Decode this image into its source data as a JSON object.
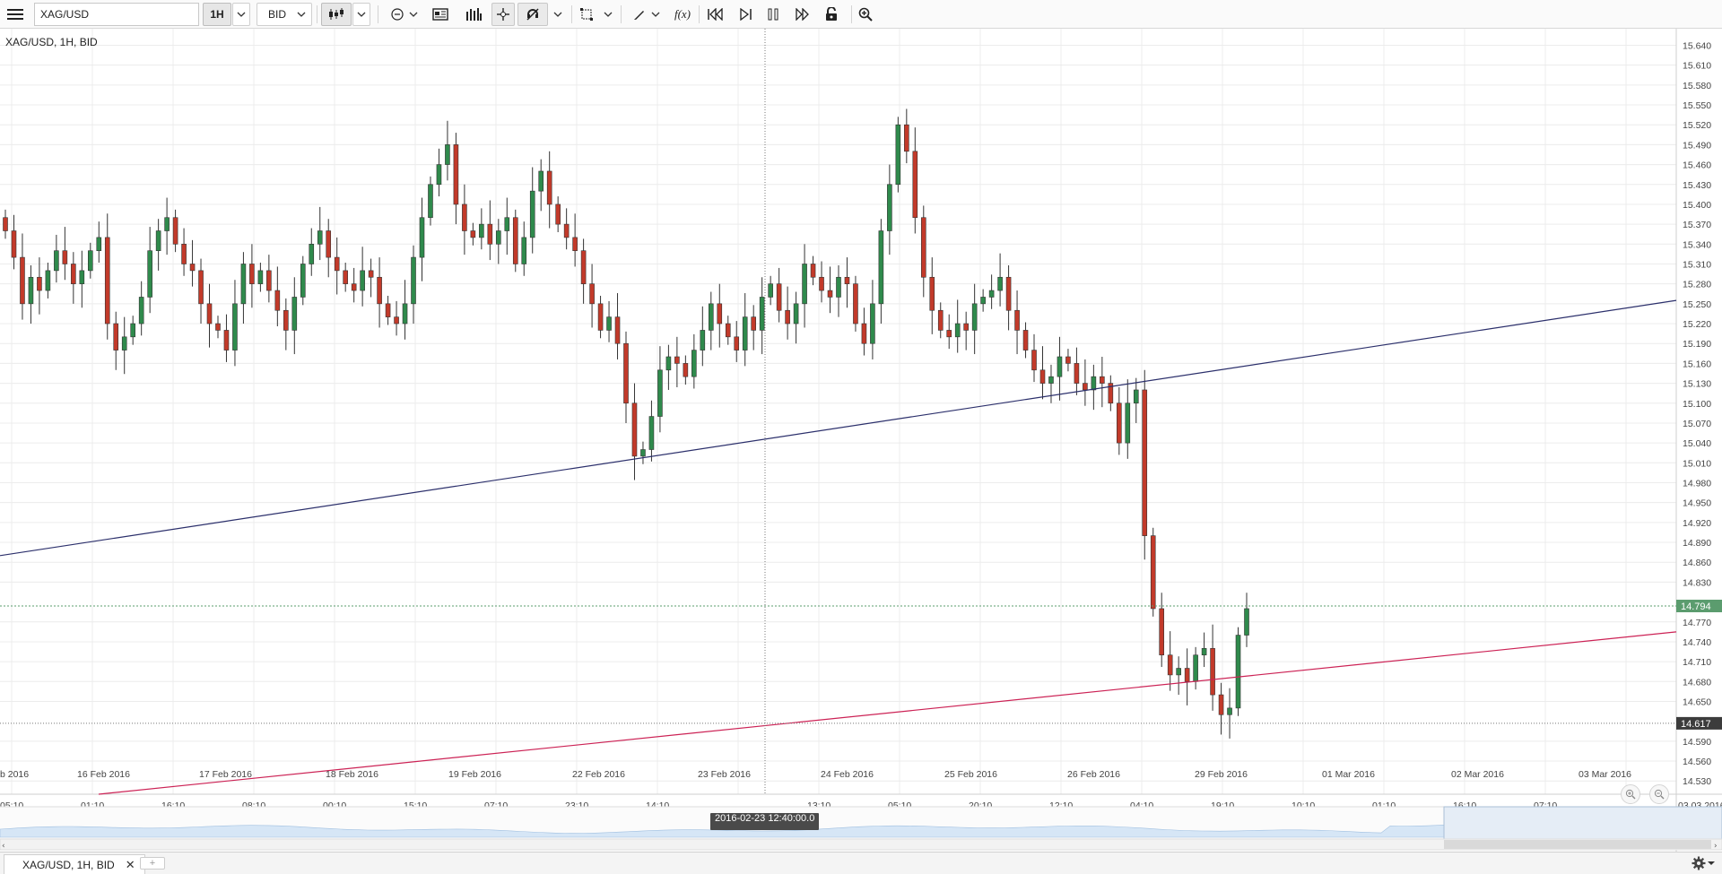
{
  "toolbar": {
    "menu_icon": "hamburger-menu-icon",
    "symbol_value": "XAG/USD",
    "period_label": "1H",
    "price_side_label": "BID",
    "icons": [
      "candlestick-chart-icon",
      "cursor-mode-icon",
      "news-icon",
      "volume-bars-icon",
      "crosshair-icon",
      "magnet-off-icon",
      "draw-rectangle-icon",
      "pencil-draw-icon",
      "function-icon",
      "rewind-start-icon",
      "skip-forward-icon",
      "pause-icon",
      "fast-forward-icon",
      "lock-icon",
      "zoom-in-icon"
    ],
    "function_label": "f(x)"
  },
  "chart": {
    "title": "XAG/USD, 1H, BID",
    "current_price_label": "14.794",
    "crosshair_price_label": "14.617",
    "crosshair_time_label": "2016-02-23 12:40:00.0",
    "colors": {
      "up": "#2f8a4c",
      "down": "#c23a2a",
      "trend_upper": "#2b2f6b",
      "trend_lower": "#cc2255",
      "price_tag": "#5b9c6e"
    }
  },
  "chart_data": {
    "type": "candlestick",
    "instrument": "XAG/USD",
    "period": "1H",
    "side": "BID",
    "ylim": [
      14.51,
      15.665
    ],
    "y_ticks": [
      "15.640",
      "15.610",
      "15.580",
      "15.550",
      "15.520",
      "15.490",
      "15.460",
      "15.430",
      "15.400",
      "15.370",
      "15.340",
      "15.310",
      "15.280",
      "15.250",
      "15.220",
      "15.190",
      "15.160",
      "15.130",
      "15.100",
      "15.070",
      "15.040",
      "15.010",
      "14.980",
      "14.950",
      "14.920",
      "14.890",
      "14.860",
      "14.830",
      "14.770",
      "14.740",
      "14.710",
      "14.680",
      "14.650",
      "14.590",
      "14.560",
      "14.530"
    ],
    "date_labels": [
      "b 2016",
      "16 Feb 2016",
      "17 Feb 2016",
      "18 Feb 2016",
      "19 Feb 2016",
      "22 Feb 2016",
      "23 Feb 2016",
      "24 Feb 2016",
      "25 Feb 2016",
      "26 Feb 2016",
      "29 Feb 2016",
      "01 Mar 2016",
      "02 Mar 2016",
      "03 Mar 2016"
    ],
    "time_labels": [
      "05:10",
      "01:10",
      "16:10",
      "08:10",
      "00:10",
      "15:10",
      "07:10",
      "23:10",
      "14:10",
      "",
      "13:10",
      "05:10",
      "20:10",
      "12:10",
      "04:10",
      "19:10",
      "10:10",
      "01:10",
      "16:10",
      "07:10",
      "03.03.2016"
    ],
    "closes": [
      15.36,
      15.32,
      15.25,
      15.29,
      15.27,
      15.3,
      15.33,
      15.31,
      15.28,
      15.3,
      15.33,
      15.35,
      15.22,
      15.18,
      15.2,
      15.22,
      15.26,
      15.33,
      15.36,
      15.38,
      15.34,
      15.31,
      15.3,
      15.25,
      15.22,
      15.21,
      15.18,
      15.25,
      15.31,
      15.28,
      15.3,
      15.27,
      15.24,
      15.21,
      15.26,
      15.31,
      15.34,
      15.36,
      15.32,
      15.3,
      15.28,
      15.27,
      15.3,
      15.29,
      15.25,
      15.23,
      15.22,
      15.25,
      15.32,
      15.38,
      15.43,
      15.46,
      15.49,
      15.4,
      15.36,
      15.35,
      15.37,
      15.34,
      15.36,
      15.38,
      15.31,
      15.35,
      15.42,
      15.45,
      15.4,
      15.37,
      15.35,
      15.33,
      15.28,
      15.25,
      15.21,
      15.23,
      15.19,
      15.1,
      15.02,
      15.03,
      15.08,
      15.15,
      15.17,
      15.16,
      15.14,
      15.18,
      15.21,
      15.25,
      15.22,
      15.2,
      15.18,
      15.23,
      15.21,
      15.26,
      15.28,
      15.24,
      15.22,
      15.25,
      15.31,
      15.29,
      15.27,
      15.26,
      15.29,
      15.28,
      15.22,
      15.19,
      15.25,
      15.36,
      15.43,
      15.52,
      15.48,
      15.38,
      15.29,
      15.24,
      15.21,
      15.2,
      15.22,
      15.21,
      15.25,
      15.26,
      15.27,
      15.29,
      15.24,
      15.21,
      15.18,
      15.15,
      15.13,
      15.14,
      15.17,
      15.16,
      15.13,
      15.12,
      15.14,
      15.13,
      15.1,
      15.04,
      15.1,
      15.12,
      14.9,
      14.79,
      14.72,
      14.69,
      14.7,
      14.68,
      14.72,
      14.73,
      14.66,
      14.63,
      14.64,
      14.75,
      14.79
    ],
    "trendlines": [
      {
        "name": "upper",
        "from": [
          "15 Feb 2016 05:10",
          14.87
        ],
        "to": [
          "03 Mar 2016",
          15.255
        ]
      },
      {
        "name": "lower",
        "from": [
          "16 Feb 2016 01:10",
          14.51
        ],
        "to": [
          "03 Mar 2016",
          14.755
        ]
      }
    ],
    "current_price": 14.794,
    "crosshair_price": 14.617,
    "crosshair_time": "2016-02-23 12:40:00.0"
  },
  "tabs": {
    "active_label": "XAG/USD, 1H, BID",
    "close_icon": "close-icon",
    "add_icon": "add-tab-icon",
    "settings_icon": "gear-icon"
  }
}
